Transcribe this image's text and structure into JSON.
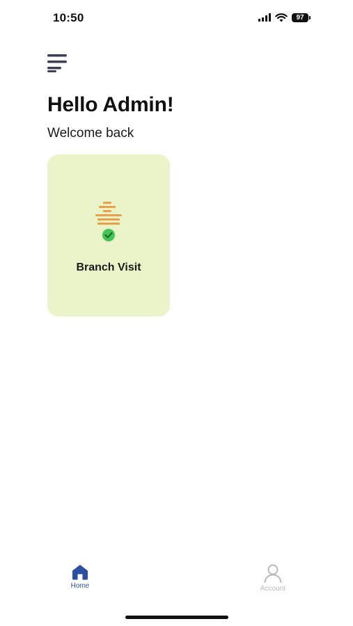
{
  "status_bar": {
    "time": "10:50",
    "battery": "97"
  },
  "header": {
    "title": "Hello Admin!",
    "subtitle": "Welcome back"
  },
  "tiles": [
    {
      "label": "Branch Visit",
      "icon": "branch-visit-icon"
    }
  ],
  "bottom_nav": {
    "items": [
      {
        "label": "Home",
        "icon": "home-icon",
        "active": true
      },
      {
        "label": "Account",
        "icon": "account-icon",
        "active": false
      }
    ]
  },
  "colors": {
    "tile_background": "#ebf3c8",
    "accent": "#2a4fa3",
    "inactive": "#b9b9b9",
    "icon_orange": "#e9a048",
    "check_green": "#3fc653"
  }
}
